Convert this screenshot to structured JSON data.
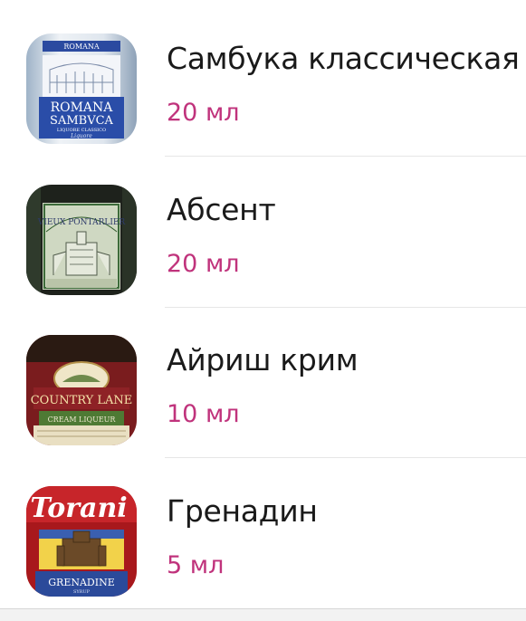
{
  "ingredients": [
    {
      "name": "Самбука классическая",
      "amount": "20 мл",
      "label_text": [
        "ROMANA",
        "ROMANA",
        "SAMBVCA",
        "LIQUORE CLASSICO",
        "Liquore"
      ]
    },
    {
      "name": "Абсент",
      "amount": "20 мл",
      "label_text": [
        "VIEUX PONTARLIER"
      ]
    },
    {
      "name": "Айриш крим",
      "amount": "10 мл",
      "label_text": [
        "COUNTRY LANE",
        "CREAM LIQUEUR"
      ]
    },
    {
      "name": "Гренадин",
      "amount": "5 мл",
      "label_text": [
        "Torani",
        "GRENADINE",
        "SYRUP"
      ]
    }
  ],
  "colors": {
    "accent": "#c0337c",
    "text": "#1a1a1a",
    "separator": "#e6e6e6"
  }
}
